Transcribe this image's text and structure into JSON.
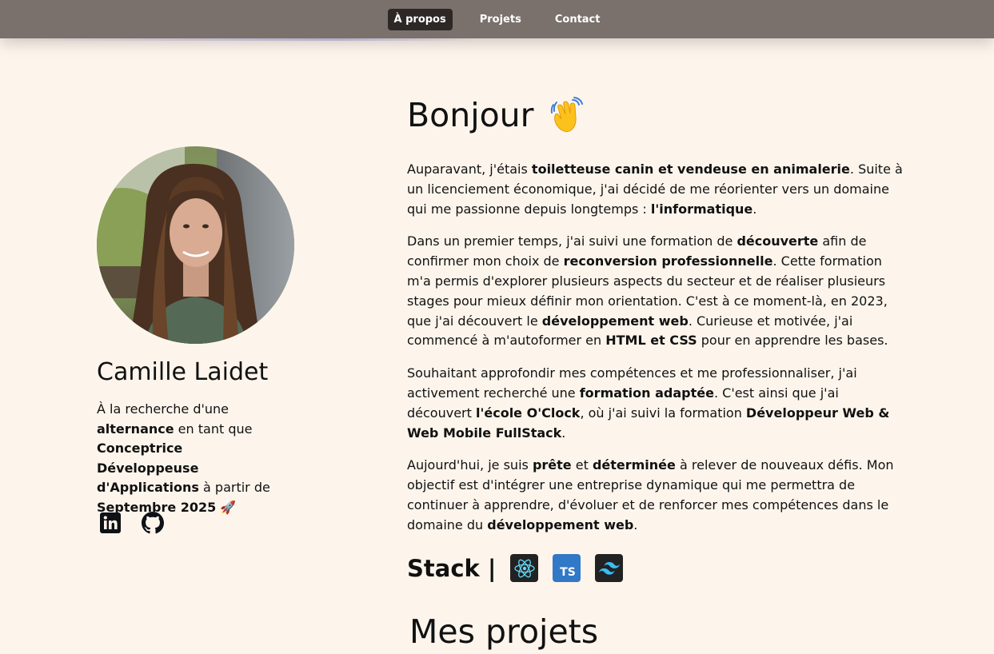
{
  "nav": {
    "items": [
      {
        "label": "À propos",
        "active": true
      },
      {
        "label": "Projets",
        "active": false
      },
      {
        "label": "Contact",
        "active": false
      }
    ]
  },
  "profile": {
    "name": "Camille Laidet",
    "tagline": [
      {
        "text": "À la recherche d'une ",
        "bold": false
      },
      {
        "text": "alternance",
        "bold": true
      },
      {
        "text": " en tant que ",
        "bold": false
      },
      {
        "text": "Conceptrice Développeuse d'Applications",
        "bold": true
      },
      {
        "text": " à partir de ",
        "bold": false
      },
      {
        "text": "Septembre 2025",
        "bold": true
      },
      {
        "text": " 🚀",
        "bold": false
      }
    ],
    "socials": [
      "linkedin-icon",
      "github-icon"
    ]
  },
  "about": {
    "title": "Bonjour",
    "title_emoji": "waving-hand-icon",
    "paragraphs": [
      [
        {
          "text": "Auparavant, j'étais ",
          "bold": false
        },
        {
          "text": "toiletteuse canin et vendeuse en animalerie",
          "bold": true
        },
        {
          "text": ". Suite à un licenciement économique, j'ai décidé de me réorienter vers un domaine qui me passionne depuis longtemps : ",
          "bold": false
        },
        {
          "text": "l'informatique",
          "bold": true
        },
        {
          "text": ".",
          "bold": false
        }
      ],
      [
        {
          "text": "Dans un premier temps, j'ai suivi une formation de ",
          "bold": false
        },
        {
          "text": "découverte",
          "bold": true
        },
        {
          "text": " afin de confirmer mon choix de ",
          "bold": false
        },
        {
          "text": "reconversion professionnelle",
          "bold": true
        },
        {
          "text": ". Cette formation m'a permis d'explorer plusieurs aspects du secteur et de réaliser plusieurs stages pour mieux définir mon orientation. C'est à ce moment-là, en 2023, que j'ai découvert le ",
          "bold": false
        },
        {
          "text": "développement web",
          "bold": true
        },
        {
          "text": ". Curieuse et motivée, j'ai commencé à m'autoformer en ",
          "bold": false
        },
        {
          "text": "HTML et CSS",
          "bold": true
        },
        {
          "text": " pour en apprendre les bases.",
          "bold": false
        }
      ],
      [
        {
          "text": "Souhaitant approfondir mes compétences et me professionnaliser, j'ai activement recherché une ",
          "bold": false
        },
        {
          "text": "formation adaptée",
          "bold": true
        },
        {
          "text": ". C'est ainsi que j'ai découvert ",
          "bold": false
        },
        {
          "text": "l'école O'Clock",
          "bold": true
        },
        {
          "text": ", où j'ai suivi la formation ",
          "bold": false
        },
        {
          "text": "Développeur Web & Web Mobile FullStack",
          "bold": true
        },
        {
          "text": ".",
          "bold": false
        }
      ],
      [
        {
          "text": "Aujourd'hui, je suis ",
          "bold": false
        },
        {
          "text": "prête",
          "bold": true
        },
        {
          "text": " et ",
          "bold": false
        },
        {
          "text": "déterminée",
          "bold": true
        },
        {
          "text": " à relever de nouveaux défis. Mon objectif est d'intégrer une entreprise dynamique qui me permettra de continuer à apprendre, d'évoluer et de renforcer mes compétences dans le domaine du ",
          "bold": false
        },
        {
          "text": "développement web",
          "bold": true
        },
        {
          "text": ".",
          "bold": false
        }
      ]
    ]
  },
  "stack": {
    "title": "Stack |",
    "items": [
      {
        "icon": "react-icon",
        "bg": "#222222"
      },
      {
        "icon": "typescript-icon",
        "bg": "#3178c6",
        "label": "TS"
      },
      {
        "icon": "tailwind-icon",
        "bg": "#222222"
      }
    ]
  },
  "projects": {
    "title": "Mes projets"
  }
}
